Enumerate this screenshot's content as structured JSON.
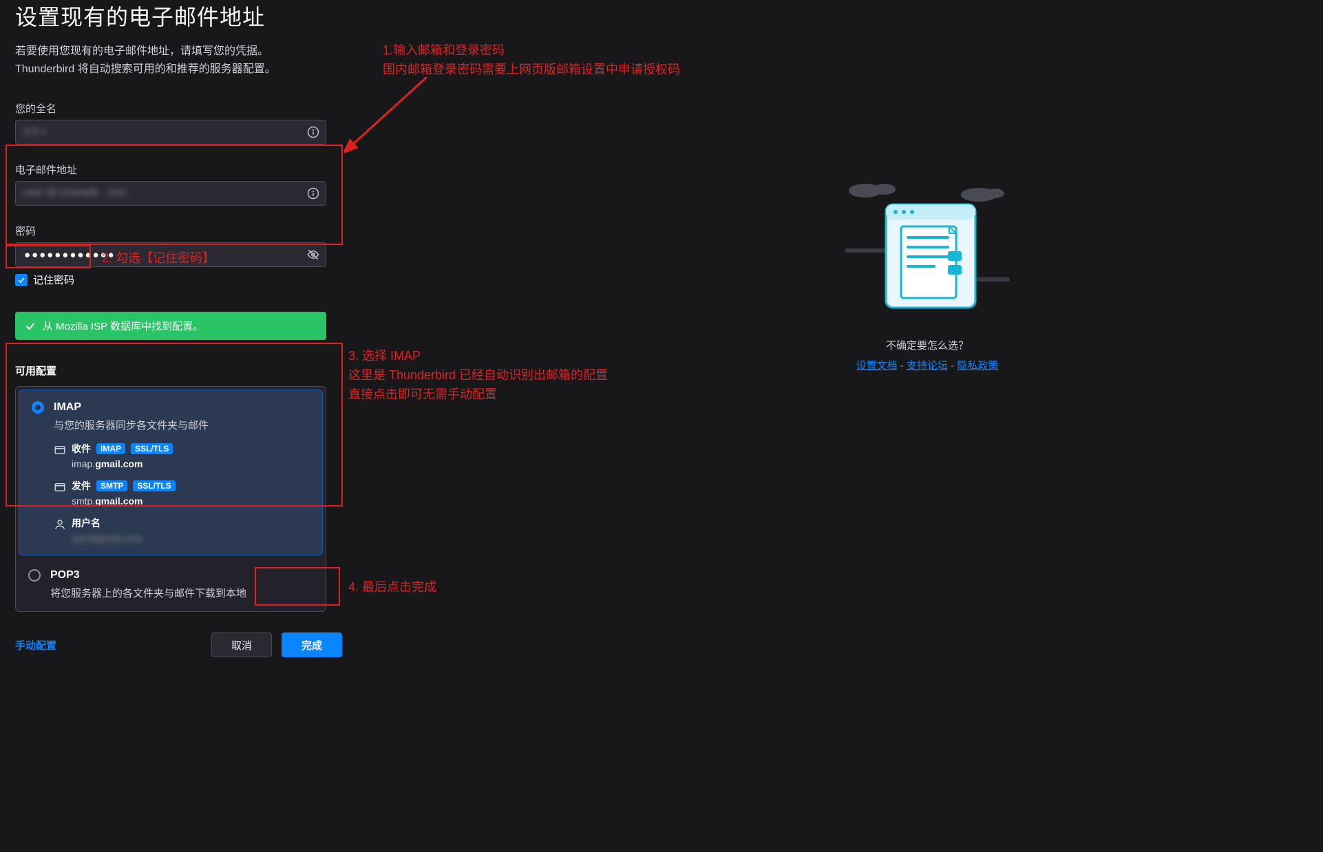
{
  "title": "设置现有的电子邮件地址",
  "subtitle_line1": "若要使用您现有的电子邮件地址，请填写您的凭据。",
  "subtitle_line2": "Thunderbird 将自动搜索可用的和推荐的服务器配置。",
  "fields": {
    "fullname_label": "您的全名",
    "fullname_value": "        ",
    "email_label": "电子邮件地址",
    "email_value": "                        ",
    "password_label": "密码",
    "password_value": "●●●●●●●●●●●●",
    "remember_label": "记住密码"
  },
  "status_text": "从 Mozilla ISP 数据库中找到配置。",
  "available_label": "可用配置",
  "config": {
    "imap": {
      "title": "IMAP",
      "desc": "与您的服务器同步各文件夹与邮件",
      "incoming_label": "收件",
      "incoming_badge1": "IMAP",
      "incoming_badge2": "SSL/TLS",
      "incoming_server_pre": "imap.",
      "incoming_server_b": "gmail.com",
      "outgoing_label": "发件",
      "outgoing_badge1": "SMTP",
      "outgoing_badge2": "SSL/TLS",
      "outgoing_server_pre": "smtp.",
      "outgoing_server_b": "gmail.com",
      "user_label": "用户名",
      "user_value": "                              "
    },
    "pop3": {
      "title": "POP3",
      "desc": "将您服务器上的各文件夹与邮件下载到本地"
    }
  },
  "buttons": {
    "manual": "手动配置",
    "cancel": "取消",
    "done": "完成"
  },
  "help": {
    "title": "不确定要怎么选？",
    "link1": "设置文档",
    "link2": "支持论坛",
    "link3": "隐私政策",
    "sep": " - "
  },
  "annotations": {
    "a1_l1": "1.输入邮箱和登录密码",
    "a1_l2": "   国内邮箱登录密码需要上网页版邮箱设置中申请授权码",
    "a2": "2. 勾选【记住密码】",
    "a3_l1": "3. 选择 IMAP",
    "a3_l2": "   这里是 Thunderbird 已经自动识别出邮箱的配置",
    "a3_l3": "   直接点击即可无需手动配置",
    "a4": "4. 最后点击完成"
  }
}
